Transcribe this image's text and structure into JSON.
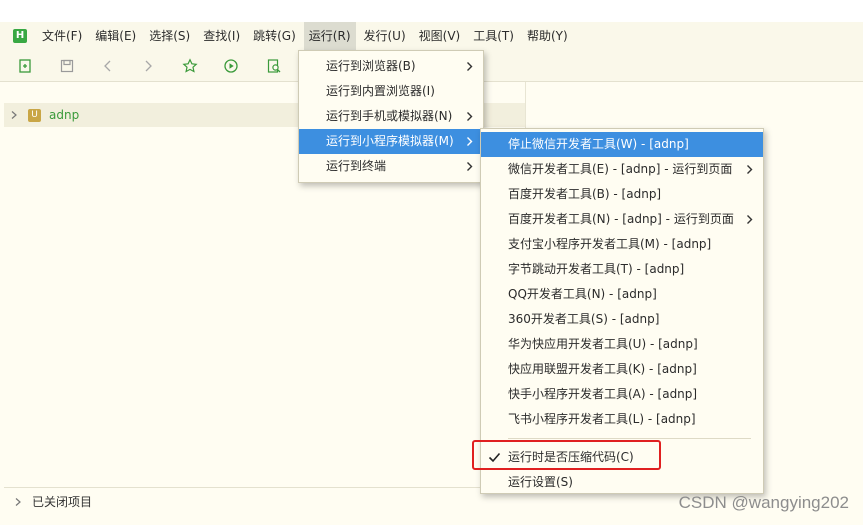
{
  "menubar": {
    "items": [
      "文件(F)",
      "编辑(E)",
      "选择(S)",
      "查找(I)",
      "跳转(G)",
      "运行(R)",
      "发行(U)",
      "视图(V)",
      "工具(T)",
      "帮助(Y)"
    ],
    "active_item": "运行(R)",
    "logo_text": "H"
  },
  "toolbar": {
    "icons": [
      "new-file-icon",
      "save-icon",
      "back-icon",
      "forward-icon",
      "favorite-icon",
      "run-icon",
      "preview-icon"
    ]
  },
  "project_tree": {
    "project_badge": "U",
    "project_name": "adnp",
    "closed_projects_label": "已关闭项目"
  },
  "run_menu": {
    "items": [
      {
        "label": "运行到浏览器(B)",
        "submenu": true
      },
      {
        "label": "运行到内置浏览器(I)",
        "submenu": false
      },
      {
        "label": "运行到手机或模拟器(N)",
        "submenu": true
      },
      {
        "label": "运行到小程序模拟器(M)",
        "submenu": true,
        "highlighted": true
      },
      {
        "label": "运行到终端",
        "submenu": true
      }
    ]
  },
  "miniprogram_menu": {
    "items": [
      {
        "label": "停止微信开发者工具(W) - [adnp]",
        "submenu": false,
        "highlighted": true
      },
      {
        "label": "微信开发者工具(E) - [adnp] - 运行到页面",
        "submenu": true
      },
      {
        "label": "百度开发者工具(B) - [adnp]",
        "submenu": false
      },
      {
        "label": "百度开发者工具(N) - [adnp] - 运行到页面",
        "submenu": true
      },
      {
        "label": "支付宝小程序开发者工具(M) - [adnp]",
        "submenu": false
      },
      {
        "label": "字节跳动开发者工具(T) - [adnp]",
        "submenu": false
      },
      {
        "label": "QQ开发者工具(N) - [adnp]",
        "submenu": false
      },
      {
        "label": "360开发者工具(S) - [adnp]",
        "submenu": false
      },
      {
        "label": "华为快应用开发者工具(U) - [adnp]",
        "submenu": false
      },
      {
        "label": "快应用联盟开发者工具(K) - [adnp]",
        "submenu": false
      },
      {
        "label": "快手小程序开发者工具(A) - [adnp]",
        "submenu": false
      },
      {
        "label": "飞书小程序开发者工具(L) - [adnp]",
        "submenu": false
      }
    ],
    "compress_option": {
      "label": "运行时是否压缩代码(C)",
      "checked": true
    },
    "settings_label": "运行设置(S)"
  },
  "watermark": "CSDN @wangying202",
  "colors": {
    "highlight": "#3d8fe0",
    "annotation_box": "#e02020",
    "project_name": "#3a9a3a",
    "logo": "#39a843"
  }
}
